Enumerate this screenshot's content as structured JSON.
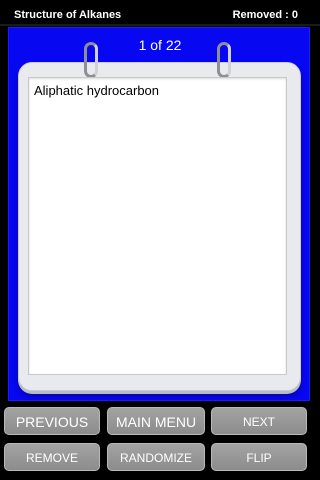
{
  "header": {
    "title": "Structure of Alkanes",
    "removed_label": "Removed : 0"
  },
  "card": {
    "counter": "1 of 22",
    "text": "Aliphatic hydrocarbon"
  },
  "buttons": {
    "previous": "PREVIOUS",
    "main_menu": "MAIN MENU",
    "next": "NEXT",
    "remove": "REMOVE",
    "randomize": "RANDOMIZE",
    "flip": "FLIP"
  },
  "colors": {
    "panel": "#0707f2",
    "background": "#000000",
    "button": "#999999"
  }
}
